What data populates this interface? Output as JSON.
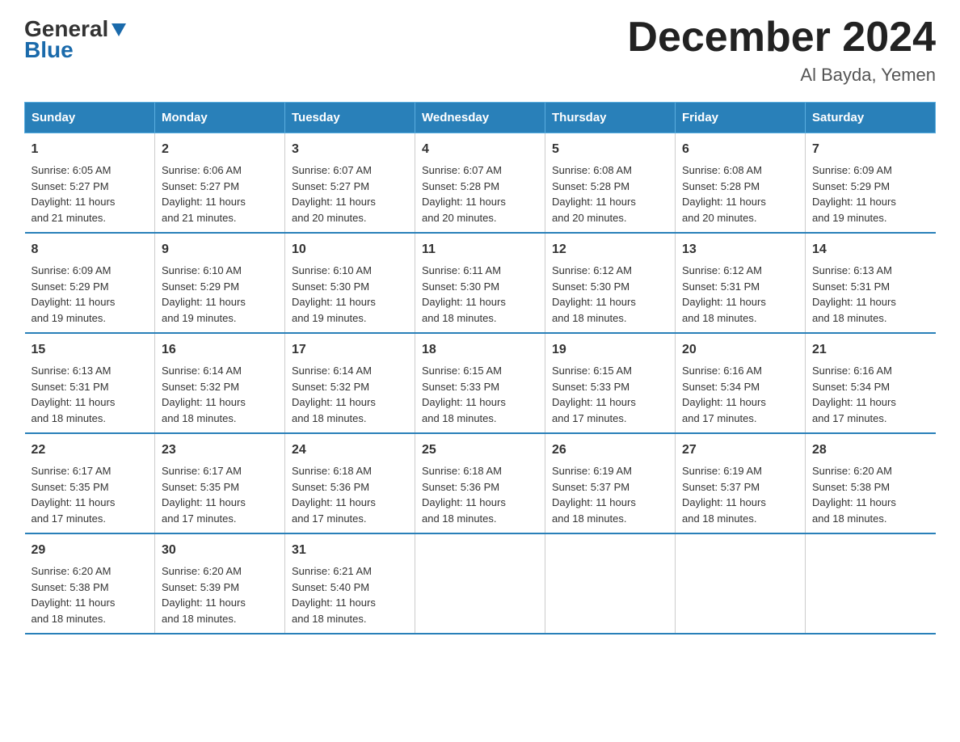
{
  "logo": {
    "general": "General",
    "blue": "Blue",
    "triangle_label": "logo-triangle"
  },
  "title": "December 2024",
  "location": "Al Bayda, Yemen",
  "days_of_week": [
    "Sunday",
    "Monday",
    "Tuesday",
    "Wednesday",
    "Thursday",
    "Friday",
    "Saturday"
  ],
  "weeks": [
    [
      {
        "day": "1",
        "sunrise": "6:05 AM",
        "sunset": "5:27 PM",
        "daylight": "11 hours and 21 minutes."
      },
      {
        "day": "2",
        "sunrise": "6:06 AM",
        "sunset": "5:27 PM",
        "daylight": "11 hours and 21 minutes."
      },
      {
        "day": "3",
        "sunrise": "6:07 AM",
        "sunset": "5:27 PM",
        "daylight": "11 hours and 20 minutes."
      },
      {
        "day": "4",
        "sunrise": "6:07 AM",
        "sunset": "5:28 PM",
        "daylight": "11 hours and 20 minutes."
      },
      {
        "day": "5",
        "sunrise": "6:08 AM",
        "sunset": "5:28 PM",
        "daylight": "11 hours and 20 minutes."
      },
      {
        "day": "6",
        "sunrise": "6:08 AM",
        "sunset": "5:28 PM",
        "daylight": "11 hours and 20 minutes."
      },
      {
        "day": "7",
        "sunrise": "6:09 AM",
        "sunset": "5:29 PM",
        "daylight": "11 hours and 19 minutes."
      }
    ],
    [
      {
        "day": "8",
        "sunrise": "6:09 AM",
        "sunset": "5:29 PM",
        "daylight": "11 hours and 19 minutes."
      },
      {
        "day": "9",
        "sunrise": "6:10 AM",
        "sunset": "5:29 PM",
        "daylight": "11 hours and 19 minutes."
      },
      {
        "day": "10",
        "sunrise": "6:10 AM",
        "sunset": "5:30 PM",
        "daylight": "11 hours and 19 minutes."
      },
      {
        "day": "11",
        "sunrise": "6:11 AM",
        "sunset": "5:30 PM",
        "daylight": "11 hours and 18 minutes."
      },
      {
        "day": "12",
        "sunrise": "6:12 AM",
        "sunset": "5:30 PM",
        "daylight": "11 hours and 18 minutes."
      },
      {
        "day": "13",
        "sunrise": "6:12 AM",
        "sunset": "5:31 PM",
        "daylight": "11 hours and 18 minutes."
      },
      {
        "day": "14",
        "sunrise": "6:13 AM",
        "sunset": "5:31 PM",
        "daylight": "11 hours and 18 minutes."
      }
    ],
    [
      {
        "day": "15",
        "sunrise": "6:13 AM",
        "sunset": "5:31 PM",
        "daylight": "11 hours and 18 minutes."
      },
      {
        "day": "16",
        "sunrise": "6:14 AM",
        "sunset": "5:32 PM",
        "daylight": "11 hours and 18 minutes."
      },
      {
        "day": "17",
        "sunrise": "6:14 AM",
        "sunset": "5:32 PM",
        "daylight": "11 hours and 18 minutes."
      },
      {
        "day": "18",
        "sunrise": "6:15 AM",
        "sunset": "5:33 PM",
        "daylight": "11 hours and 18 minutes."
      },
      {
        "day": "19",
        "sunrise": "6:15 AM",
        "sunset": "5:33 PM",
        "daylight": "11 hours and 17 minutes."
      },
      {
        "day": "20",
        "sunrise": "6:16 AM",
        "sunset": "5:34 PM",
        "daylight": "11 hours and 17 minutes."
      },
      {
        "day": "21",
        "sunrise": "6:16 AM",
        "sunset": "5:34 PM",
        "daylight": "11 hours and 17 minutes."
      }
    ],
    [
      {
        "day": "22",
        "sunrise": "6:17 AM",
        "sunset": "5:35 PM",
        "daylight": "11 hours and 17 minutes."
      },
      {
        "day": "23",
        "sunrise": "6:17 AM",
        "sunset": "5:35 PM",
        "daylight": "11 hours and 17 minutes."
      },
      {
        "day": "24",
        "sunrise": "6:18 AM",
        "sunset": "5:36 PM",
        "daylight": "11 hours and 17 minutes."
      },
      {
        "day": "25",
        "sunrise": "6:18 AM",
        "sunset": "5:36 PM",
        "daylight": "11 hours and 18 minutes."
      },
      {
        "day": "26",
        "sunrise": "6:19 AM",
        "sunset": "5:37 PM",
        "daylight": "11 hours and 18 minutes."
      },
      {
        "day": "27",
        "sunrise": "6:19 AM",
        "sunset": "5:37 PM",
        "daylight": "11 hours and 18 minutes."
      },
      {
        "day": "28",
        "sunrise": "6:20 AM",
        "sunset": "5:38 PM",
        "daylight": "11 hours and 18 minutes."
      }
    ],
    [
      {
        "day": "29",
        "sunrise": "6:20 AM",
        "sunset": "5:38 PM",
        "daylight": "11 hours and 18 minutes."
      },
      {
        "day": "30",
        "sunrise": "6:20 AM",
        "sunset": "5:39 PM",
        "daylight": "11 hours and 18 minutes."
      },
      {
        "day": "31",
        "sunrise": "6:21 AM",
        "sunset": "5:40 PM",
        "daylight": "11 hours and 18 minutes."
      },
      null,
      null,
      null,
      null
    ]
  ],
  "labels": {
    "sunrise": "Sunrise:",
    "sunset": "Sunset:",
    "daylight": "Daylight:"
  }
}
